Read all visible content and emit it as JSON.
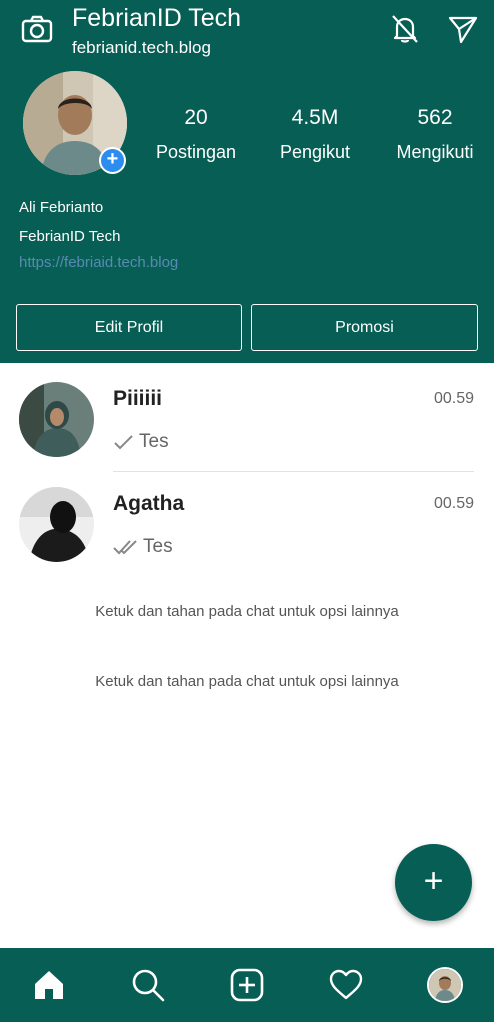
{
  "header": {
    "title": "FebrianID Tech",
    "subtitle": "febrianid.tech.blog",
    "camera_icon": "camera-icon",
    "notifications_off_icon": "bell-off-icon",
    "send_icon": "send-icon"
  },
  "profile": {
    "stats": [
      {
        "value": "20",
        "label": "Postingan"
      },
      {
        "value": "4.5M",
        "label": "Pengikut"
      },
      {
        "value": "562",
        "label": "Mengikuti"
      }
    ],
    "name": "Ali Febrianto",
    "category": "FebrianID Tech",
    "link": "https://febriaid.tech.blog",
    "edit_button": "Edit Profil",
    "promo_button": "Promosi"
  },
  "chats": [
    {
      "name": "Piiiiii",
      "time": "00.59",
      "message": "Tes",
      "status": "sent"
    },
    {
      "name": "Agatha",
      "time": "00.59",
      "message": "Tes",
      "status": "delivered"
    }
  ],
  "hints": [
    "Ketuk dan tahan pada chat untuk opsi lainnya",
    "Ketuk dan tahan pada chat untuk opsi lainnya"
  ],
  "fab_label": "+",
  "navigation": [
    "home-icon",
    "search-icon",
    "add-post-icon",
    "heart-icon",
    "profile-avatar"
  ],
  "colors": {
    "primary": "#075e54",
    "link": "#5a8ab3",
    "badge": "#2d8cf0"
  }
}
